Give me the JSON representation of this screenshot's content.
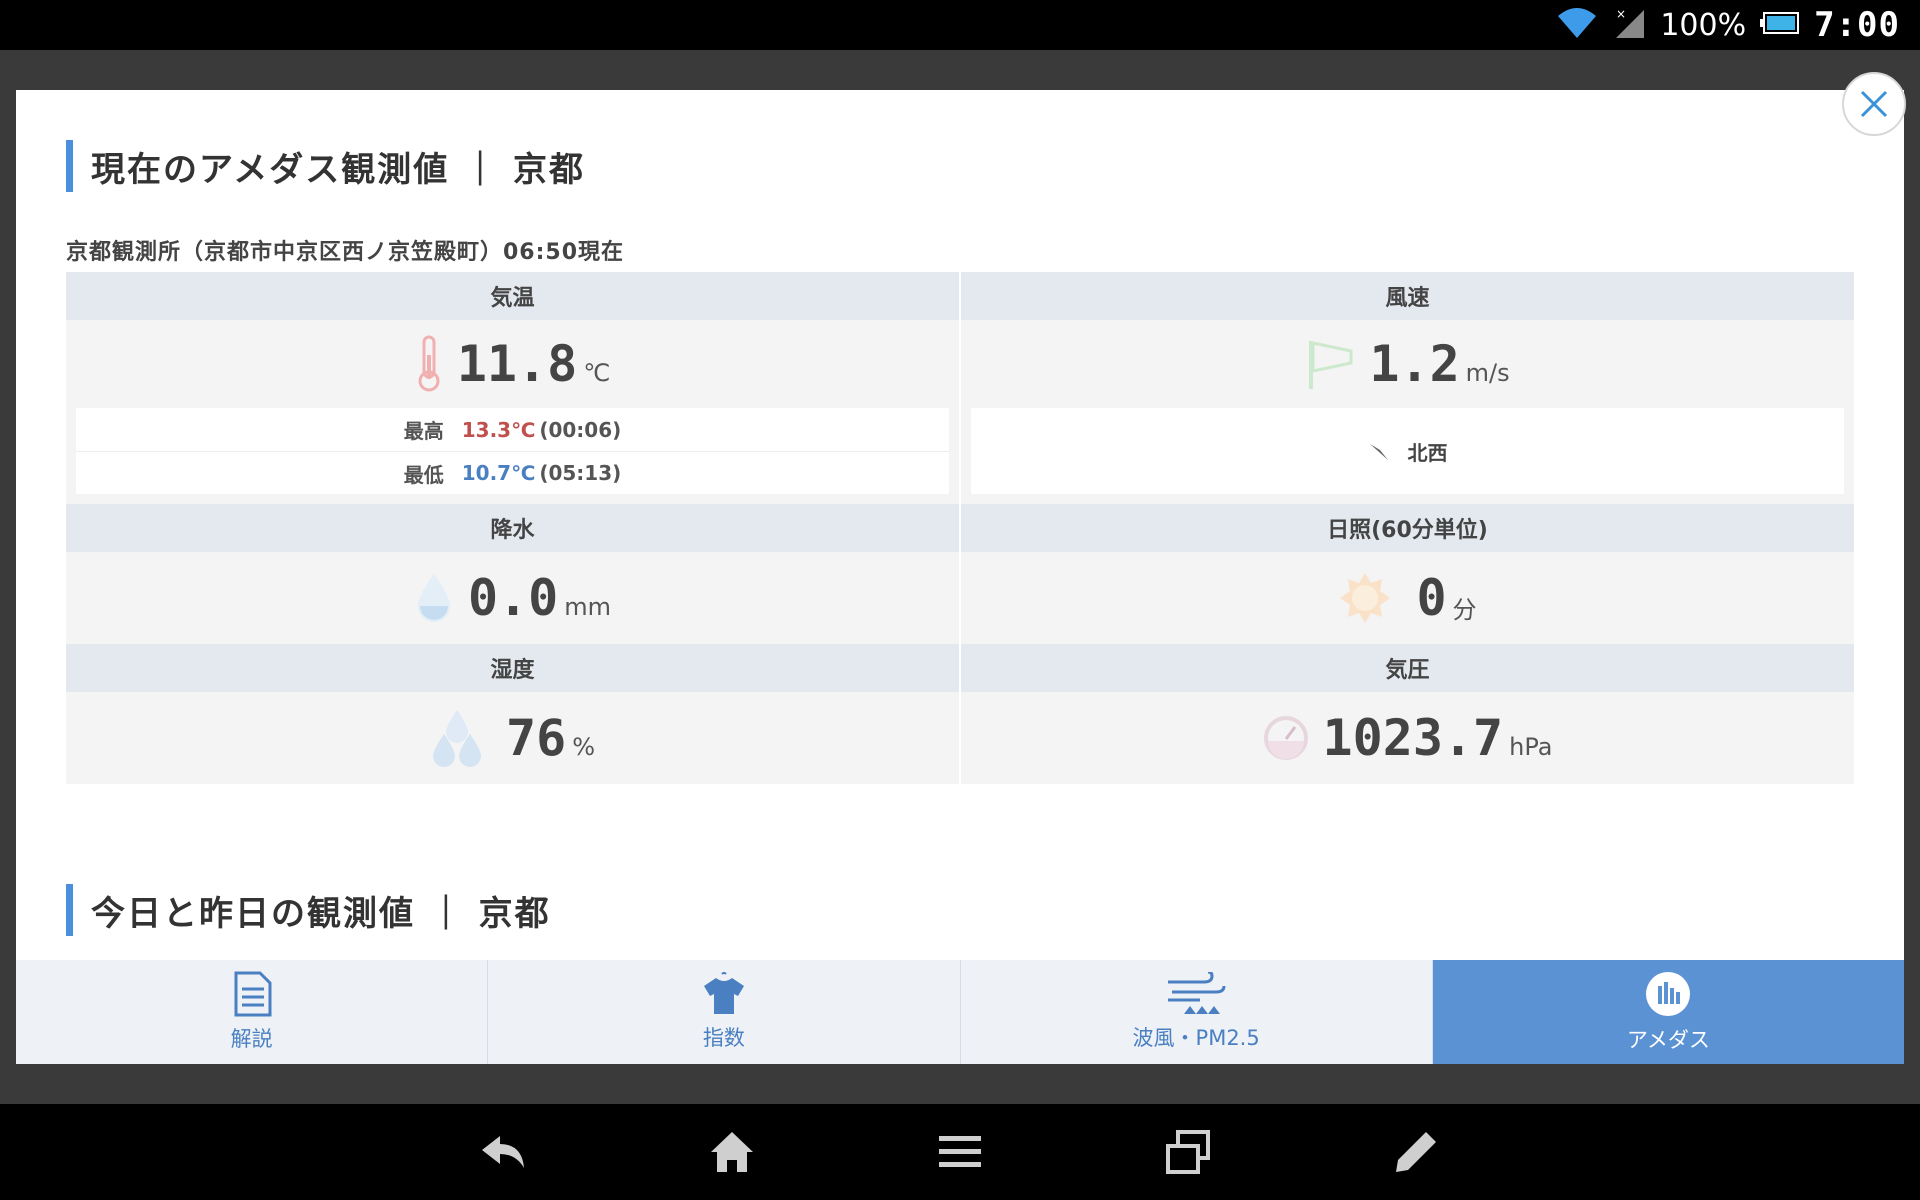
{
  "status_bar": {
    "battery": "100%",
    "time": "7:00"
  },
  "section1": {
    "title": "現在のアメダス観測値 ｜ 京都"
  },
  "station": {
    "info": "京都観測所（京都市中京区西ノ京笠殿町）06:50現在"
  },
  "temperature": {
    "header": "気温",
    "value": "11.8",
    "unit": "℃",
    "max_label": "最高",
    "max_value": "13.3℃",
    "max_time": "(00:06)",
    "min_label": "最低",
    "min_value": "10.7℃",
    "min_time": "(05:13)"
  },
  "wind": {
    "header": "風速",
    "value": "1.2",
    "unit": "m/s",
    "direction": "北西"
  },
  "precipitation": {
    "header": "降水",
    "value": "0.0",
    "unit": "mm"
  },
  "sunshine": {
    "header": "日照(60分単位)",
    "value": "0",
    "unit": "分"
  },
  "humidity": {
    "header": "湿度",
    "value": "76",
    "unit": "%"
  },
  "pressure": {
    "header": "気圧",
    "value": "1023.7",
    "unit": "hPa"
  },
  "section2": {
    "title": "今日と昨日の観測値 ｜ 京都"
  },
  "tabs": [
    {
      "label": "解説",
      "icon": "document-icon"
    },
    {
      "label": "指数",
      "icon": "shirt-icon"
    },
    {
      "label": "波風・PM2.5",
      "icon": "wave-wind-icon"
    },
    {
      "label": "アメダス",
      "icon": "bar-chart-icon",
      "active": true
    }
  ],
  "colors": {
    "accent": "#4a8fdc",
    "active_tab": "#5b92d4",
    "max_temp": "#c0504d",
    "min_temp": "#4a7fc1"
  }
}
